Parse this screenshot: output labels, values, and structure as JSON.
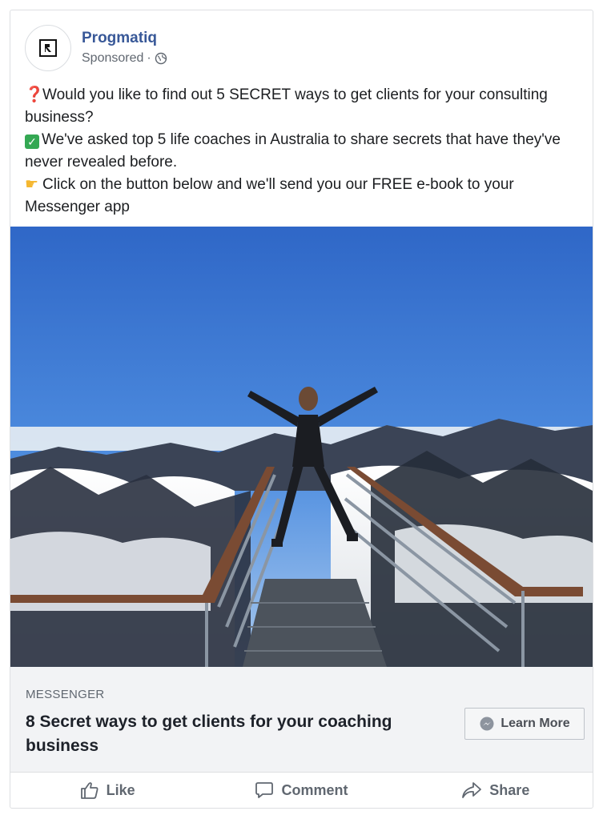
{
  "post": {
    "page_name": "Progmatiq",
    "sponsored_label": "Sponsored",
    "separator": "·",
    "body_lines": [
      {
        "emoji": "question-mark-icon",
        "text": "Would you like to find out 5 SECRET ways to get clients for your consulting business?"
      },
      {
        "emoji": "check-mark-icon",
        "text": "We've asked top 5 life coaches in Australia to share secrets that have they've never revealed before."
      },
      {
        "emoji": "pointing-hand-icon",
        "text": "Click on the button below and we'll send you our FREE e-book to your Messenger app"
      }
    ],
    "image_alt": "person-on-mountain-observation-deck"
  },
  "link_preview": {
    "source": "MESSENGER",
    "title": "8 Secret ways to get clients for your coaching business",
    "cta_label": "Learn More"
  },
  "actions": {
    "like": "Like",
    "comment": "Comment",
    "share": "Share"
  },
  "colors": {
    "brand_link": "#385898",
    "muted": "#606770",
    "link_bg": "#f2f3f5"
  }
}
